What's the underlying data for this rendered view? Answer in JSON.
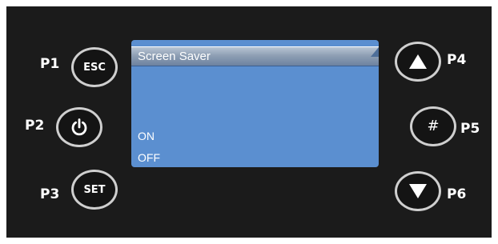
{
  "screen": {
    "title": "Screen Saver",
    "options": [
      "ON",
      "OFF"
    ]
  },
  "keys": {
    "p1": {
      "label": "P1",
      "button_text": "ESC"
    },
    "p2": {
      "label": "P2",
      "icon": "power-icon"
    },
    "p3": {
      "label": "P3",
      "button_text": "SET"
    },
    "p4": {
      "label": "P4",
      "icon": "arrow-up-icon"
    },
    "p5": {
      "label": "P5",
      "button_text": "#"
    },
    "p6": {
      "label": "P6",
      "icon": "arrow-down-icon"
    }
  },
  "colors": {
    "panel": "#1b1b1b",
    "screen": "#5b8fd0",
    "button_border": "#cfcfcf",
    "text": "#ffffff"
  }
}
